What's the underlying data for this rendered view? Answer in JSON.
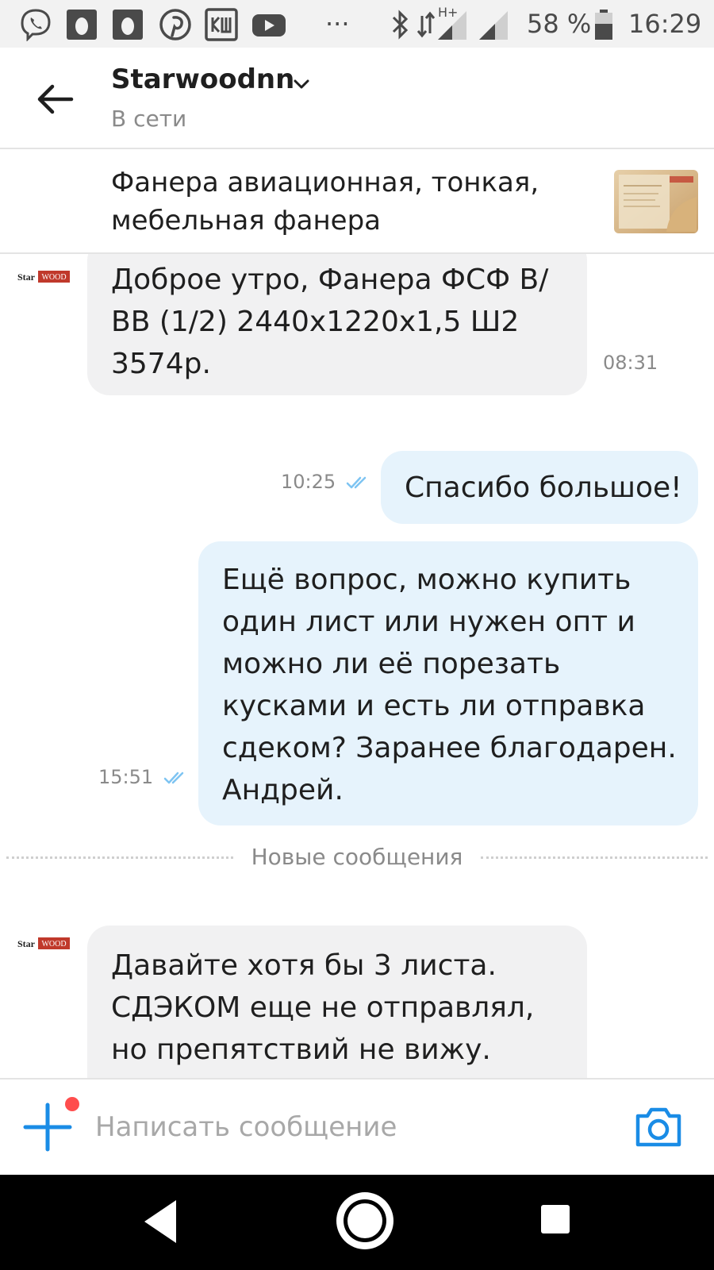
{
  "status_bar": {
    "network_type": "H+",
    "battery": "58 %",
    "time": "16:29",
    "more_indicator": "···",
    "icons": [
      "viber-icon",
      "notification-drop-icon",
      "notification-drop-icon",
      "pinterest-icon",
      "vk-icon",
      "youtube-icon",
      "bluetooth-icon",
      "signal-icon",
      "signal-icon",
      "battery-icon"
    ]
  },
  "header": {
    "title": "Starwoodnn",
    "status": "В сети"
  },
  "listing": {
    "title": "Фанера авиационная, тонкая, мебельная фанера"
  },
  "messages": [
    {
      "direction": "in",
      "avatar_text": [
        "Star",
        "WOOD"
      ],
      "text": "Доброе утро, Фанера ФСФ В/\nВВ (1/2) 2440х1220х1,5 Ш2\n3574р.",
      "time": "08:31"
    },
    {
      "direction": "out",
      "text": "Спасибо большое!",
      "time": "10:25"
    },
    {
      "direction": "out",
      "text": "Ещё вопрос,  можно купить\nодин лист или нужен опт и\nможно ли её порезать\nкусками и есть ли отправка\nсдеком? Заранее благодарен.\nАндрей.",
      "time": "15:51"
    },
    {
      "direction": "in",
      "avatar_text": [
        "Star",
        "WOOD"
      ],
      "text": "Давайте хотя бы 3 листа.\nСДЭКОМ еще не отправлял,\nно препятствий не вижу."
    }
  ],
  "divider": {
    "label": "Новые сообщения"
  },
  "composer": {
    "placeholder": "Написать сообщение"
  },
  "colors": {
    "accent": "#1a8ce6",
    "outgoing_bubble": "#e6f3fc",
    "incoming_bubble": "#f1f1f2",
    "read_check": "#7ec4f2",
    "notification_dot": "#ff4d4d",
    "logo_red": "#c0392b"
  }
}
